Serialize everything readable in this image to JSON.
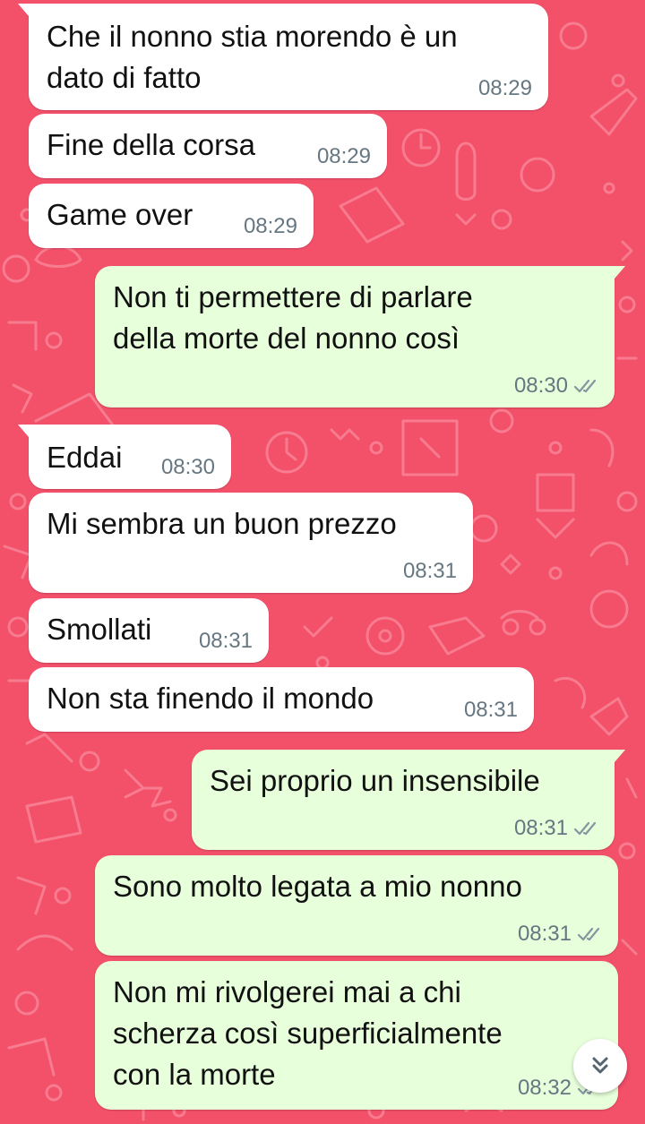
{
  "theme": {
    "wallpaper_color": "#f3506a",
    "incoming_bubble": "#ffffff",
    "outgoing_bubble": "#e7ffdb",
    "meta_color": "#667781"
  },
  "messages": [
    {
      "direction": "in",
      "text": "Che il nonno stia morendo è un\ndato di fatto",
      "time": "08:29"
    },
    {
      "direction": "in",
      "text": "Fine della corsa",
      "time": "08:29"
    },
    {
      "direction": "in",
      "text": "Game over",
      "time": "08:29"
    },
    {
      "direction": "out",
      "text": "Non ti permettere di parlare\ndella morte del nonno così",
      "time": "08:30",
      "status_icon": "double-check-icon"
    },
    {
      "direction": "in",
      "text": "Eddai",
      "time": "08:30"
    },
    {
      "direction": "in",
      "text": "Mi sembra un buon prezzo",
      "time": "08:31"
    },
    {
      "direction": "in",
      "text": "Smollati",
      "time": "08:31"
    },
    {
      "direction": "in",
      "text": "Non sta finendo il mondo",
      "time": "08:31"
    },
    {
      "direction": "out",
      "text": "Sei proprio un insensibile",
      "time": "08:31",
      "status_icon": "double-check-icon"
    },
    {
      "direction": "out",
      "text": "Sono molto legata a mio nonno",
      "time": "08:31",
      "status_icon": "double-check-icon"
    },
    {
      "direction": "out",
      "text": "Non mi rivolgerei mai a chi\nscherza così superficialmente\ncon la morte",
      "time": "08:32",
      "status_icon": "double-check-icon"
    }
  ],
  "scroll_button": {
    "icon": "double-chevron-down-icon"
  }
}
